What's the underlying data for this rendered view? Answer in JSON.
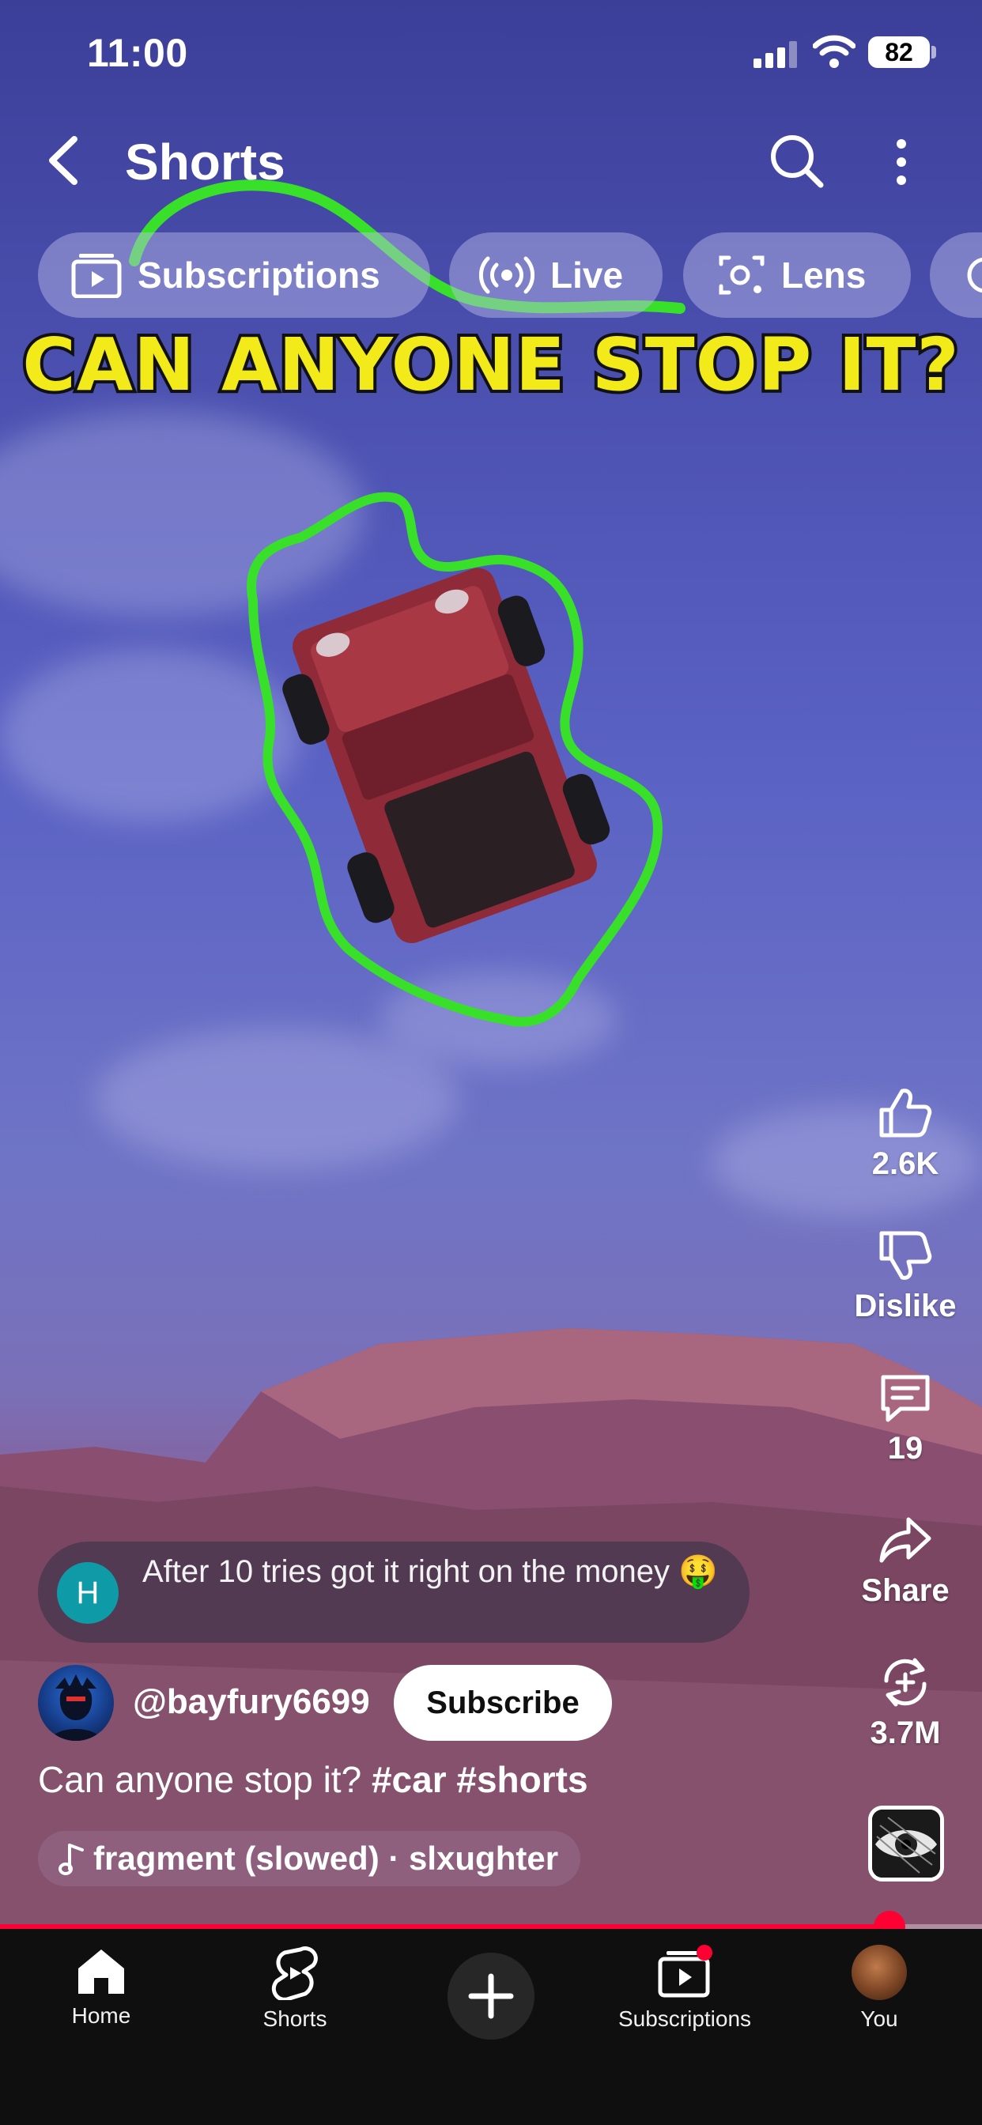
{
  "status_bar": {
    "time": "11:00",
    "battery": "82"
  },
  "top_bar": {
    "title": "Shorts",
    "back_icon": "chevron-left-icon",
    "search_icon": "search-icon",
    "more_icon": "more-vertical-icon"
  },
  "chips": [
    {
      "label": "Subscriptions",
      "icon": "subscriptions-icon"
    },
    {
      "label": "Live",
      "icon": "live-icon"
    },
    {
      "label": "Lens",
      "icon": "lens-icon"
    }
  ],
  "video": {
    "headline": "CAN ANYONE STOP IT?"
  },
  "actions": {
    "like": {
      "label": "2.6K",
      "icon": "thumbs-up-icon"
    },
    "dislike": {
      "label": "Dislike",
      "icon": "thumbs-down-icon"
    },
    "comments": {
      "label": "19",
      "icon": "comment-icon"
    },
    "share": {
      "label": "Share",
      "icon": "share-icon"
    },
    "remix": {
      "label": "3.7M",
      "icon": "remix-icon"
    }
  },
  "comment": {
    "avatar_letter": "H",
    "text": "After 10 tries got it right on the money 🤑"
  },
  "channel": {
    "handle": "@bayfury6699",
    "subscribe_label": "Subscribe"
  },
  "caption": {
    "text": "Can anyone stop it?",
    "tags": "#car #shorts"
  },
  "sound": {
    "label": "fragment (slowed) · slxughter"
  },
  "progress": {
    "fraction": 0.906
  },
  "bottom_nav": {
    "home": "Home",
    "shorts": "Shorts",
    "subscriptions": "Subscriptions",
    "you": "You"
  },
  "colors": {
    "accent": "#ff0033",
    "headline": "#f2ea19",
    "outline": "#38e02a"
  }
}
